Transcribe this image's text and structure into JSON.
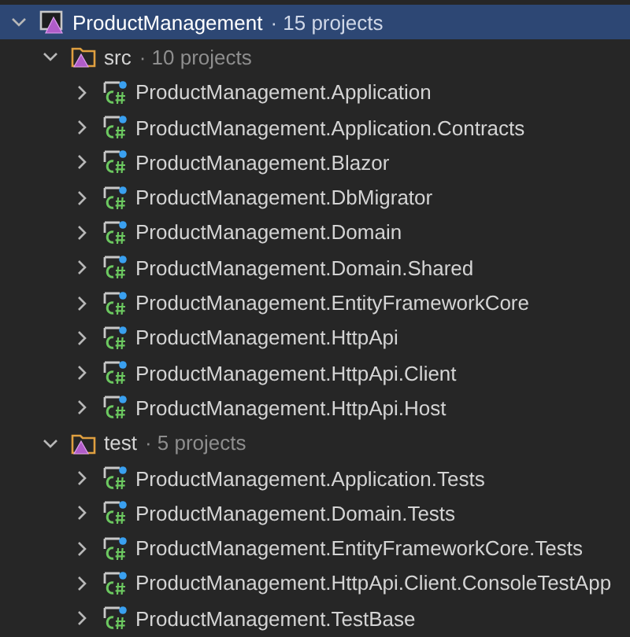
{
  "tree": [
    {
      "kind": "solution",
      "name": "ProductManagement",
      "count": "· 15 projects",
      "expanded": true,
      "selected": true,
      "children": [
        {
          "kind": "folder",
          "name": "src",
          "count": "· 10 projects",
          "expanded": true,
          "selected": false,
          "children": [
            {
              "kind": "project",
              "name": "ProductManagement.Application",
              "expanded": false,
              "selected": false
            },
            {
              "kind": "project",
              "name": "ProductManagement.Application.Contracts",
              "expanded": false,
              "selected": false
            },
            {
              "kind": "project",
              "name": "ProductManagement.Blazor",
              "expanded": false,
              "selected": false
            },
            {
              "kind": "project",
              "name": "ProductManagement.DbMigrator",
              "expanded": false,
              "selected": false
            },
            {
              "kind": "project",
              "name": "ProductManagement.Domain",
              "expanded": false,
              "selected": false
            },
            {
              "kind": "project",
              "name": "ProductManagement.Domain.Shared",
              "expanded": false,
              "selected": false
            },
            {
              "kind": "project",
              "name": "ProductManagement.EntityFrameworkCore",
              "expanded": false,
              "selected": false
            },
            {
              "kind": "project",
              "name": "ProductManagement.HttpApi",
              "expanded": false,
              "selected": false
            },
            {
              "kind": "project",
              "name": "ProductManagement.HttpApi.Client",
              "expanded": false,
              "selected": false
            },
            {
              "kind": "project",
              "name": "ProductManagement.HttpApi.Host",
              "expanded": false,
              "selected": false
            }
          ]
        },
        {
          "kind": "folder",
          "name": "test",
          "count": "· 5 projects",
          "expanded": true,
          "selected": false,
          "children": [
            {
              "kind": "project",
              "name": "ProductManagement.Application.Tests",
              "expanded": false,
              "selected": false
            },
            {
              "kind": "project",
              "name": "ProductManagement.Domain.Tests",
              "expanded": false,
              "selected": false
            },
            {
              "kind": "project",
              "name": "ProductManagement.EntityFrameworkCore.Tests",
              "expanded": false,
              "selected": false
            },
            {
              "kind": "project",
              "name": "ProductManagement.HttpApi.Client.ConsoleTestApp",
              "expanded": false,
              "selected": false
            },
            {
              "kind": "project",
              "name": "ProductManagement.TestBase",
              "expanded": false,
              "selected": false
            }
          ]
        }
      ]
    }
  ]
}
